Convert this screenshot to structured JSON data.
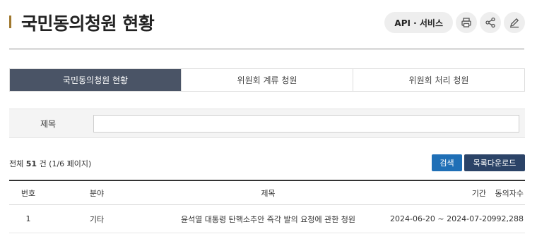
{
  "header": {
    "title": "국민동의청원 현황",
    "api_label": "API · 서비스",
    "icons": [
      "print-icon",
      "share-icon",
      "edit-icon"
    ]
  },
  "tabs": [
    {
      "label": "국민동의청원 현황",
      "active": true
    },
    {
      "label": "위원회 계류 청원",
      "active": false
    },
    {
      "label": "위원회 처리 청원",
      "active": false
    }
  ],
  "search": {
    "label": "제목",
    "value": "",
    "placeholder": ""
  },
  "summary": {
    "prefix": "전체",
    "count": "51",
    "suffix": "건 (1/6 페이지)"
  },
  "actions": {
    "search_label": "검색",
    "download_label": "목록다운로드"
  },
  "table": {
    "columns": [
      "번호",
      "분야",
      "제목",
      "기간",
      "동의자수"
    ],
    "rows": [
      {
        "no": "1",
        "field": "기타",
        "title": "윤석열 대통령 탄핵소추안 즉각 발의 요청에 관한 청원",
        "period": "2024-06-20 ~ 2024-07-20",
        "agree": "992,288"
      }
    ]
  },
  "colors": {
    "title_accent": "#a0782e",
    "tab_active_bg": "#4a5466",
    "search_button": "#1f6fb6",
    "download_button": "#2b4367"
  }
}
